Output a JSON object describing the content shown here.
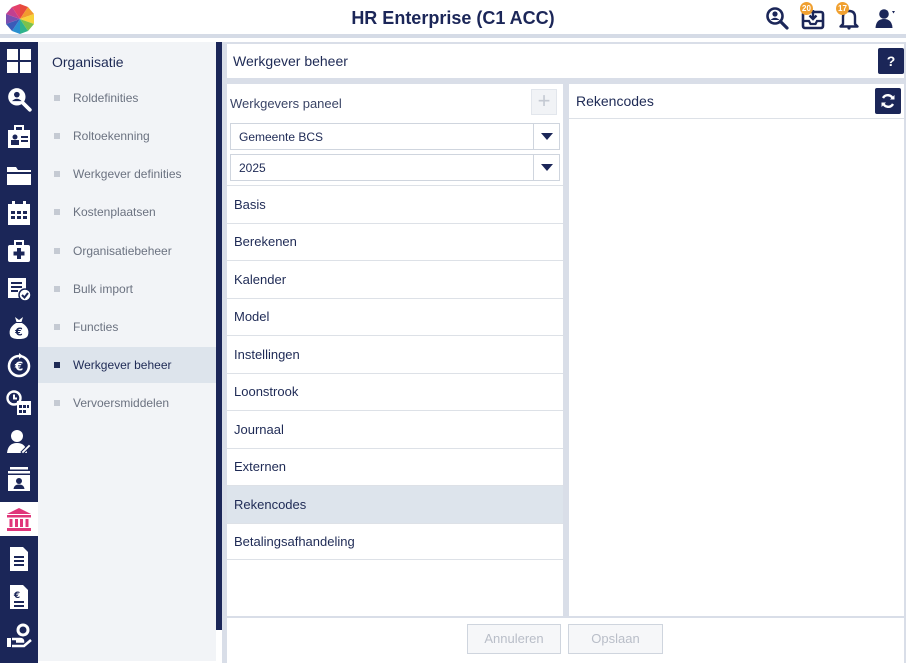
{
  "app": {
    "title": "HR Enterprise (C1 ACC)",
    "header_icons": [
      {
        "icon": "search-user-icon"
      },
      {
        "icon": "inbox-icon",
        "badge": "20"
      },
      {
        "icon": "bell-icon",
        "badge": "17"
      },
      {
        "icon": "user-icon"
      }
    ]
  },
  "rail": {
    "items": [
      {
        "icon": "dashboard-icon"
      },
      {
        "icon": "search-user-icon"
      },
      {
        "icon": "employee-badge-icon"
      },
      {
        "icon": "folder-icon"
      },
      {
        "icon": "calendar-icon"
      },
      {
        "icon": "medical-kit-icon"
      },
      {
        "icon": "checklist-icon"
      },
      {
        "icon": "money-bag-icon"
      },
      {
        "icon": "euro-cycle-icon"
      },
      {
        "icon": "schedule-icon"
      },
      {
        "icon": "person-edit-icon"
      },
      {
        "icon": "id-card-icon"
      },
      {
        "icon": "bank-icon",
        "active": true
      },
      {
        "icon": "document-icon"
      },
      {
        "icon": "euro-document-icon"
      },
      {
        "icon": "hand-coin-icon"
      }
    ],
    "accent_active": "#e0357a"
  },
  "subnav": {
    "title": "Organisatie",
    "items": [
      {
        "label": "Roldefinities"
      },
      {
        "label": "Roltoekenning"
      },
      {
        "label": "Werkgever definities"
      },
      {
        "label": "Kostenplaatsen"
      },
      {
        "label": "Organisatiebeheer"
      },
      {
        "label": "Bulk import"
      },
      {
        "label": "Functies"
      },
      {
        "label": "Werkgever beheer",
        "active": true
      },
      {
        "label": "Vervoersmiddelen"
      }
    ]
  },
  "main": {
    "title": "Werkgever beheer",
    "help_label": "?",
    "left_panel": {
      "title": "Werkgevers paneel",
      "add_label": "+",
      "employer_select": "Gemeente BCS",
      "year_select": "2025",
      "items": [
        {
          "label": "Basis"
        },
        {
          "label": "Berekenen"
        },
        {
          "label": "Kalender"
        },
        {
          "label": "Model"
        },
        {
          "label": "Instellingen"
        },
        {
          "label": "Loonstrook"
        },
        {
          "label": "Journaal"
        },
        {
          "label": "Externen"
        },
        {
          "label": "Rekencodes",
          "active": true
        },
        {
          "label": "Betalingsafhandeling"
        }
      ]
    },
    "right_panel": {
      "title": "Rekencodes"
    },
    "footer": {
      "cancel_label": "Annuleren",
      "save_label": "Opslaan"
    }
  },
  "colors": {
    "navy": "#1b2658",
    "active_row": "#dde4ec",
    "badge": "#f0a030"
  }
}
